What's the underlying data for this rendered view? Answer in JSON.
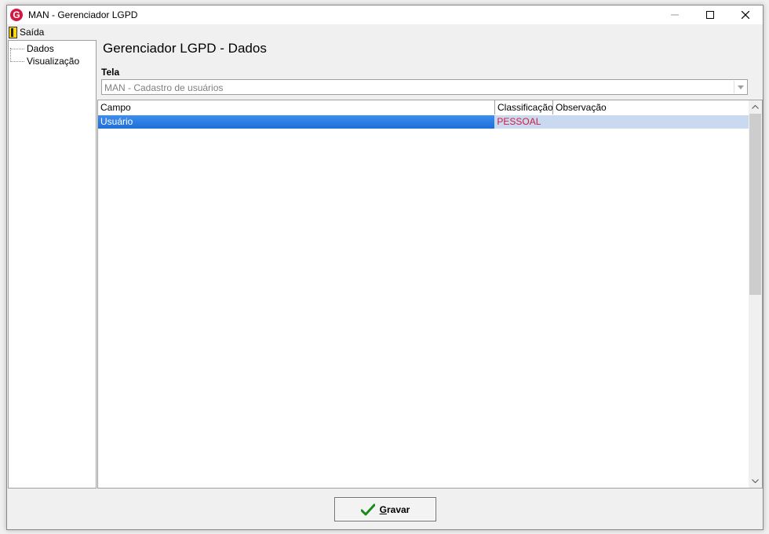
{
  "window": {
    "title": "MAN - Gerenciador LGPD",
    "app_icon_letter": "G",
    "controls": [
      "minimize-icon",
      "maximize-icon",
      "close-icon"
    ]
  },
  "menubar": {
    "exit_label": "Saída",
    "exit_icon": "exit-door-icon"
  },
  "sidebar": {
    "items": [
      {
        "label": "Dados"
      },
      {
        "label": "Visualização"
      }
    ]
  },
  "main": {
    "title": "Gerenciador LGPD - Dados",
    "screen_label": "Tela",
    "screen_select": {
      "value": "MAN - Cadastro de usuários",
      "icon": "chevron-down-icon"
    },
    "grid": {
      "columns": [
        "Campo",
        "Classificação",
        "Observação"
      ],
      "rows": [
        {
          "campo": "Usuário",
          "classificacao": "PESSOAL",
          "observacao": ""
        }
      ]
    }
  },
  "footer": {
    "save_button": {
      "label_first": "G",
      "label_rest": "ravar",
      "icon": "checkmark-icon"
    }
  },
  "colors": {
    "brand": "#d3183f",
    "selection": "#1f6fd8",
    "selection_light": "#c9daf0",
    "checkmark": "#1a8a1a"
  }
}
